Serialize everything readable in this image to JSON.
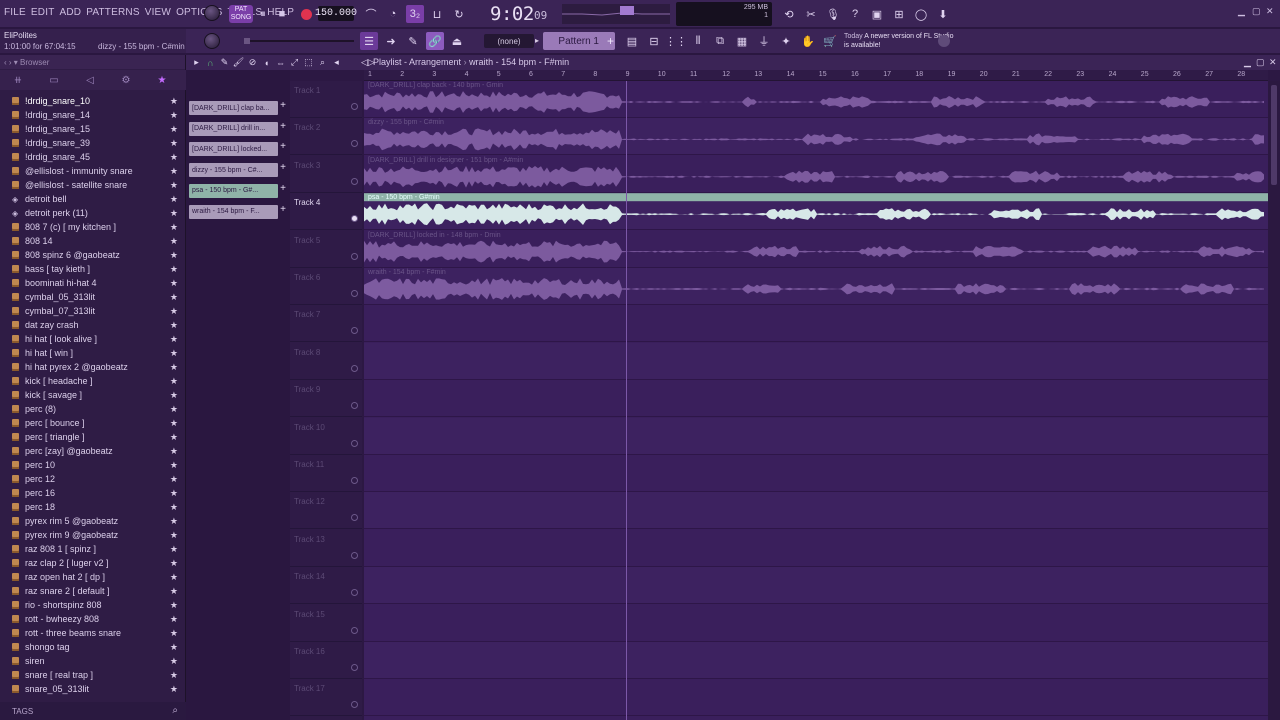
{
  "menu": [
    "FILE",
    "EDIT",
    "ADD",
    "PATTERNS",
    "VIEW",
    "OPTIONS",
    "TOOLS",
    "HELP"
  ],
  "transport": {
    "pattern_label": "PAT SONG",
    "tempo": "150.000"
  },
  "time": {
    "main": "9:02",
    "ms": "09"
  },
  "monitor": {
    "memory": "295 MB",
    "cpu": "1"
  },
  "hint": {
    "name": "EliPolites",
    "position": "1:01:00 for 67:04:15",
    "file": "dizzy - 155 bpm - C#min"
  },
  "toolbar2": {
    "snap": "(none)",
    "pattern": "Pattern 1",
    "news_date": "Today",
    "news_text": "A newer version of FL Studio is available!"
  },
  "browser": {
    "title": "Browser",
    "items": [
      {
        "label": "!drdig_snare_10",
        "type": "folder",
        "selected": true
      },
      {
        "label": "!drdig_snare_14",
        "type": "audio"
      },
      {
        "label": "!drdig_snare_15",
        "type": "audio"
      },
      {
        "label": "!drdig_snare_39",
        "type": "audio"
      },
      {
        "label": "!drdig_snare_45",
        "type": "audio"
      },
      {
        "label": "@ellislost - immunity snare",
        "type": "audio"
      },
      {
        "label": "@ellislost - satellite snare",
        "type": "audio"
      },
      {
        "label": "detroit bell",
        "type": "plugin"
      },
      {
        "label": "detroit perk (11)",
        "type": "plugin"
      },
      {
        "label": "808 7 (c) [ my kitchen ]",
        "type": "audio"
      },
      {
        "label": "808 14",
        "type": "audio"
      },
      {
        "label": "808 spinz 6 @gaobeatz",
        "type": "audio"
      },
      {
        "label": "bass [ tay kieth ]",
        "type": "audio"
      },
      {
        "label": "boominati hi-hat 4",
        "type": "audio"
      },
      {
        "label": "cymbal_05_313lit",
        "type": "audio"
      },
      {
        "label": "cymbal_07_313lit",
        "type": "audio"
      },
      {
        "label": "dat zay crash",
        "type": "audio"
      },
      {
        "label": "hi hat [ look alive ]",
        "type": "audio"
      },
      {
        "label": "hi hat [ win ]",
        "type": "audio"
      },
      {
        "label": "hi hat pyrex 2 @gaobeatz",
        "type": "audio"
      },
      {
        "label": "kick [ headache ]",
        "type": "audio"
      },
      {
        "label": "kick [ savage ]",
        "type": "audio"
      },
      {
        "label": "perc (8)",
        "type": "audio"
      },
      {
        "label": "perc [ bounce ]",
        "type": "audio"
      },
      {
        "label": "perc [ triangle ]",
        "type": "audio"
      },
      {
        "label": "perc [zay] @gaobeatz",
        "type": "audio"
      },
      {
        "label": "perc 10",
        "type": "audio"
      },
      {
        "label": "perc 12",
        "type": "audio"
      },
      {
        "label": "perc 16",
        "type": "audio"
      },
      {
        "label": "perc 18",
        "type": "audio"
      },
      {
        "label": "pyrex rim 5 @gaobeatz",
        "type": "audio"
      },
      {
        "label": "pyrex rim 9 @gaobeatz",
        "type": "audio"
      },
      {
        "label": "raz 808 1 [ spinz ]",
        "type": "audio"
      },
      {
        "label": "raz clap 2 [ luger v2 ]",
        "type": "audio"
      },
      {
        "label": "raz open hat 2 [ dp ]",
        "type": "audio"
      },
      {
        "label": "raz snare 2 [ default ]",
        "type": "audio"
      },
      {
        "label": "rio - shortspinz 808",
        "type": "audio"
      },
      {
        "label": "rott - bwheezy 808",
        "type": "audio"
      },
      {
        "label": "rott - three beams snare",
        "type": "audio"
      },
      {
        "label": "shongo tag",
        "type": "audio"
      },
      {
        "label": "siren",
        "type": "audio"
      },
      {
        "label": "snare [ real trap ]",
        "type": "audio"
      },
      {
        "label": "snare_05_313lit",
        "type": "audio"
      }
    ],
    "tags_label": "TAGS"
  },
  "playlist": {
    "title": "Playlist - Arrangement",
    "breadcrumb": "wraith - 154 bpm - F#min",
    "clips": [
      {
        "label": "[DARK_DRILL] clap ba...",
        "selected": false
      },
      {
        "label": "[DARK_DRILL] drill in...",
        "selected": false
      },
      {
        "label": "[DARK_DRILL] locked...",
        "selected": false
      },
      {
        "label": "dizzy - 155 bpm - C#...",
        "selected": false
      },
      {
        "label": "psa - 150 bpm - G#...",
        "selected": true
      },
      {
        "label": "wraith - 154 bpm - F...",
        "selected": false
      }
    ],
    "ruler": [
      "1",
      "2",
      "3",
      "4",
      "5",
      "6",
      "7",
      "8",
      "9",
      "10",
      "11",
      "12",
      "13",
      "14",
      "15",
      "16",
      "17",
      "18",
      "19",
      "20",
      "21",
      "22",
      "23",
      "24",
      "25",
      "26",
      "27",
      "28"
    ],
    "tracks": [
      {
        "name": "Track 1",
        "clip": "[DARK_DRILL] clap back - 140 bpm - Gmin"
      },
      {
        "name": "Track 2",
        "clip": "dizzy - 155 bpm - C#min"
      },
      {
        "name": "Track 3",
        "clip": "[DARK_DRILL] drill in designer - 151 bpm - A#min"
      },
      {
        "name": "Track 4",
        "clip": "psa - 150 bpm - G#min"
      },
      {
        "name": "Track 5",
        "clip": "[DARK_DRILL] locked in - 148 bpm - Dmin"
      },
      {
        "name": "Track 6",
        "clip": "wraith - 154 bpm - F#min"
      },
      {
        "name": "Track 7",
        "clip": ""
      },
      {
        "name": "Track 8",
        "clip": ""
      },
      {
        "name": "Track 9",
        "clip": ""
      },
      {
        "name": "Track 10",
        "clip": ""
      },
      {
        "name": "Track 11",
        "clip": ""
      },
      {
        "name": "Track 12",
        "clip": ""
      },
      {
        "name": "Track 13",
        "clip": ""
      },
      {
        "name": "Track 14",
        "clip": ""
      },
      {
        "name": "Track 15",
        "clip": ""
      },
      {
        "name": "Track 16",
        "clip": ""
      },
      {
        "name": "Track 17",
        "clip": ""
      }
    ],
    "active_track": 3
  },
  "colors": {
    "accent": "#c46bff",
    "selected_clip": "#8fb3a8",
    "waveform": "#b38ad6",
    "waveform_active": "#dff3ef"
  }
}
